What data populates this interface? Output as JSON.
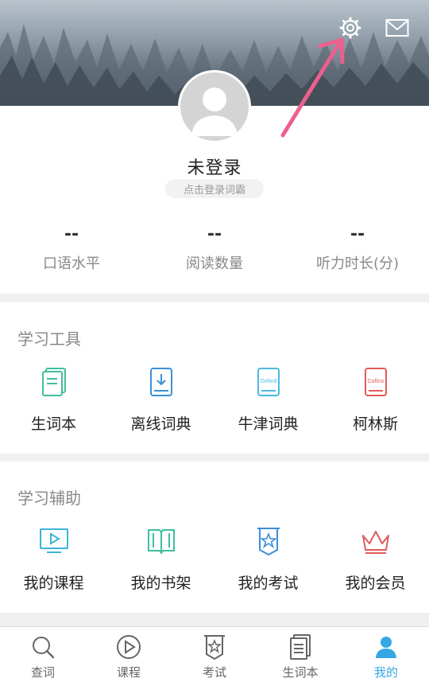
{
  "profile": {
    "name": "未登录",
    "login_hint": "点击登录词霸"
  },
  "stats": [
    {
      "value": "--",
      "label": "口语水平"
    },
    {
      "value": "--",
      "label": "阅读数量"
    },
    {
      "value": "--",
      "label": "听力时长(分)"
    }
  ],
  "tools": {
    "title": "学习工具",
    "items": [
      {
        "label": "生词本",
        "icon": "vocabulary-book-icon",
        "color": "#3fbf9f"
      },
      {
        "label": "离线词典",
        "icon": "offline-dictionary-icon",
        "color": "#3b8fd8"
      },
      {
        "label": "牛津词典",
        "icon": "oxford-dictionary-icon",
        "icon_text": "Oxford",
        "color": "#4bb8e0"
      },
      {
        "label": "柯林斯",
        "icon": "collins-dictionary-icon",
        "icon_text": "Collins",
        "color": "#e05a5a"
      }
    ]
  },
  "assist": {
    "title": "学习辅助",
    "items": [
      {
        "label": "我的课程",
        "icon": "course-video-icon",
        "color": "#3ab5d6"
      },
      {
        "label": "我的书架",
        "icon": "bookshelf-icon",
        "color": "#3fbf9f"
      },
      {
        "label": "我的考试",
        "icon": "exam-badge-icon",
        "color": "#3b8fd8"
      },
      {
        "label": "我的会员",
        "icon": "crown-icon",
        "color": "#e05a5a"
      }
    ]
  },
  "tabs": [
    {
      "label": "查词",
      "icon": "search-icon"
    },
    {
      "label": "课程",
      "icon": "play-icon"
    },
    {
      "label": "考试",
      "icon": "exam-icon"
    },
    {
      "label": "生词本",
      "icon": "notebook-icon"
    },
    {
      "label": "我的",
      "icon": "profile-icon",
      "active": true
    }
  ],
  "colors": {
    "accent": "#35a7e6",
    "annotation_arrow": "#ee5f8d"
  }
}
